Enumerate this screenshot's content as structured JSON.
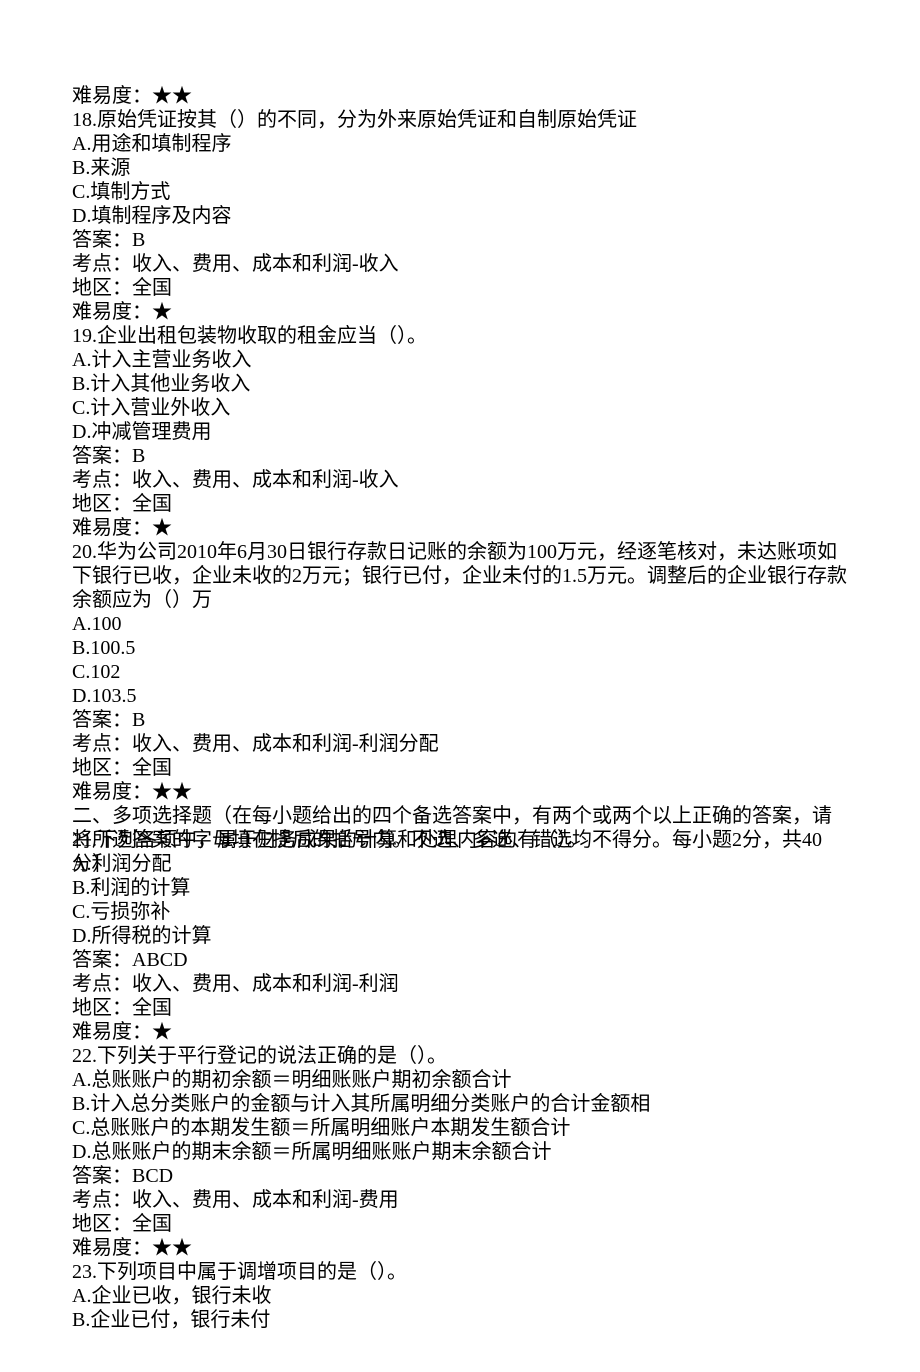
{
  "lines": [
    "难易度：★★",
    "18.原始凭证按其（）的不同，分为外来原始凭证和自制原始凭证",
    "A.用途和填制程序",
    "B.来源",
    "C.填制方式",
    "D.填制程序及内容",
    "答案：B",
    "考点：收入、费用、成本和利润-收入",
    "地区：全国",
    "难易度：★",
    "19.企业出租包装物收取的租金应当（）。",
    "A.计入主营业务收入",
    "B.计入其他业务收入",
    "C.计入营业外收入",
    "D.冲减管理费用",
    "答案：B",
    "考点：收入、费用、成本和利润-收入",
    "地区：全国",
    "难易度：★",
    "20.华为公司2010年6月30日银行存款日记账的余额为100万元，经逐笔核对，未达账项如下银行已收，企业未收的2万元；银行已付，企业未付的1.5万元。调整后的企业银行存款余额应为（）万",
    "A.100",
    "B.100.5",
    "C.102",
    "D.103.5",
    "答案：B",
    "考点：收入、费用、成本和利润-利润分配",
    "地区：全国",
    "难易度：★★",
    "二、多项选择题（在每小题给出的四个备选答案中，有两个或两个以上正确的答案，请将所选答案的字母填在提后的括号内。不选、多选、错选均不得分。每小题2分，共40分）",
    "21.下列各项中，属于财务成果的计算和处理内容的有（）。",
    "A.利润分配",
    "B.利润的计算",
    "C.亏损弥补",
    "D.所得税的计算",
    "答案：ABCD",
    "考点：收入、费用、成本和利润-利润",
    "地区：全国",
    "难易度：★",
    "22.下列关于平行登记的说法正确的是（）。",
    "A.总账账户的期初余额＝明细账账户期初余额合计",
    "B.计入总分类账户的金额与计入其所属明细分类账户的合计金额相",
    "C.总账账户的本期发生额＝所属明细账户本期发生额合计",
    "D.总账账户的期末余额＝所属明细账账户期末余额合计",
    "答案：BCD",
    "考点：收入、费用、成本和利润-费用",
    "地区：全国",
    "难易度：★★",
    "23.下列项目中属于调增项目的是（）。",
    "A.企业已收，银行未收",
    "B.企业已付，银行未付"
  ],
  "overlap_index": 28
}
